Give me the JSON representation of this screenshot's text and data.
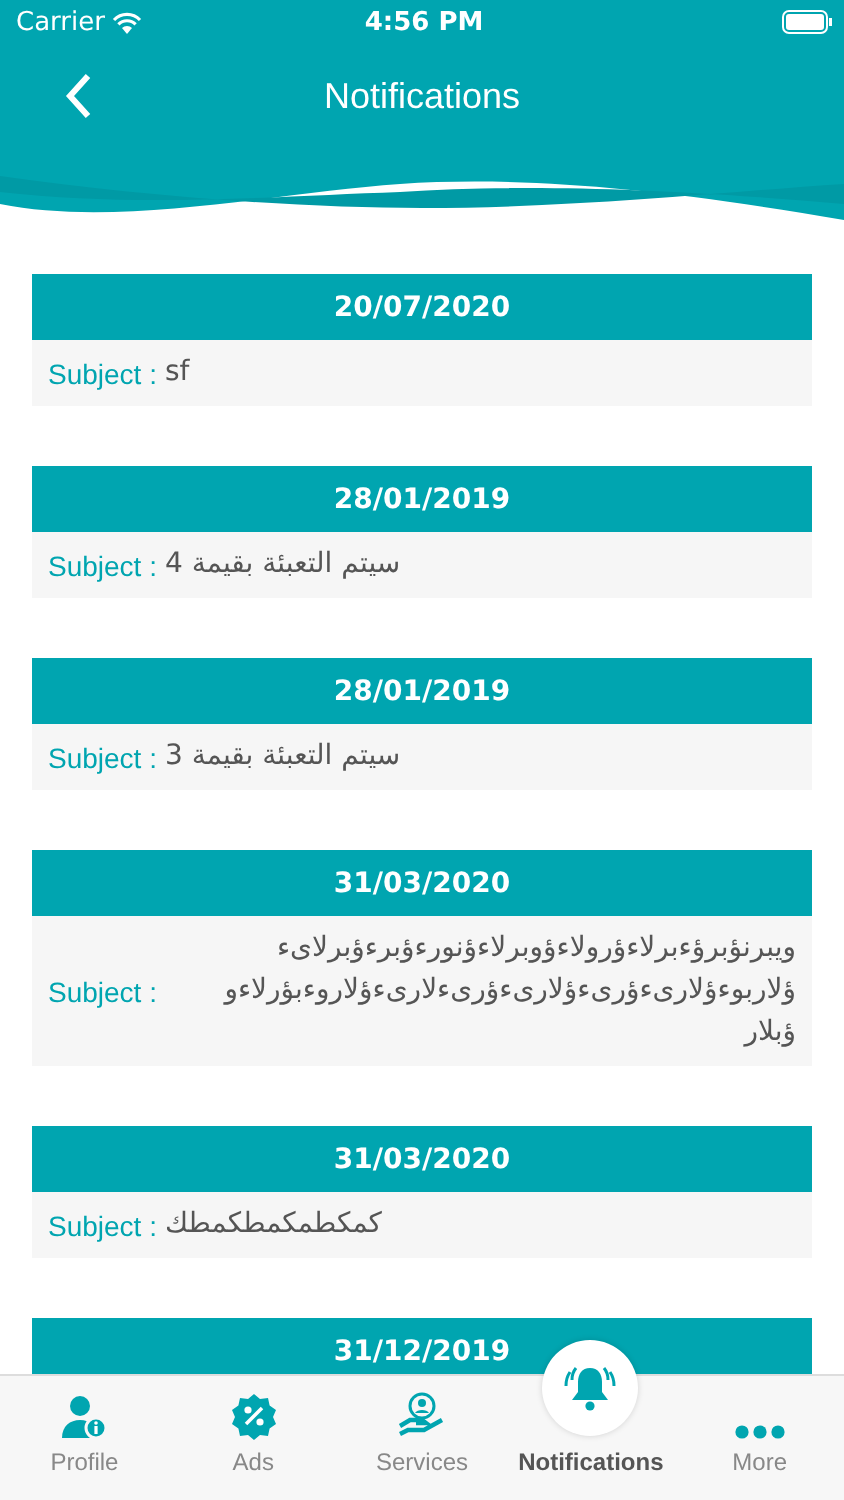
{
  "status_bar": {
    "carrier": "Carrier",
    "time": "4:56 PM"
  },
  "header": {
    "title": "Notifications"
  },
  "notifications": [
    {
      "date": "20/07/2020",
      "label": "Subject :",
      "subject": "sf"
    },
    {
      "date": "28/01/2019",
      "label": "Subject :",
      "subject": "سيتم التعبئة بقيمة 4"
    },
    {
      "date": "28/01/2019",
      "label": "Subject :",
      "subject": "سيتم التعبئة بقيمة 3"
    },
    {
      "date": "31/03/2020",
      "label": "Subject :",
      "subject": "ويبرنؤبرؤءبرلاءؤرولاءؤوبرلاءؤنورءؤبرءؤبرلاىء ؤلاربوءؤلارىءؤرىءؤلارىءؤرىءلارىءؤلاروءبؤرلاءو ؤبلار"
    },
    {
      "date": "31/03/2020",
      "label": "Subject :",
      "subject": "كمكطمكمطكمطك"
    },
    {
      "date": "31/12/2019"
    }
  ],
  "tab_bar": [
    {
      "kind": "profile",
      "label": "Profile",
      "selected": false
    },
    {
      "kind": "ads",
      "label": "Ads",
      "selected": false
    },
    {
      "kind": "services",
      "label": "Services",
      "selected": false
    },
    {
      "kind": "notifications",
      "label": "Notifications",
      "selected": true
    },
    {
      "kind": "more",
      "label": "More",
      "selected": false
    }
  ]
}
